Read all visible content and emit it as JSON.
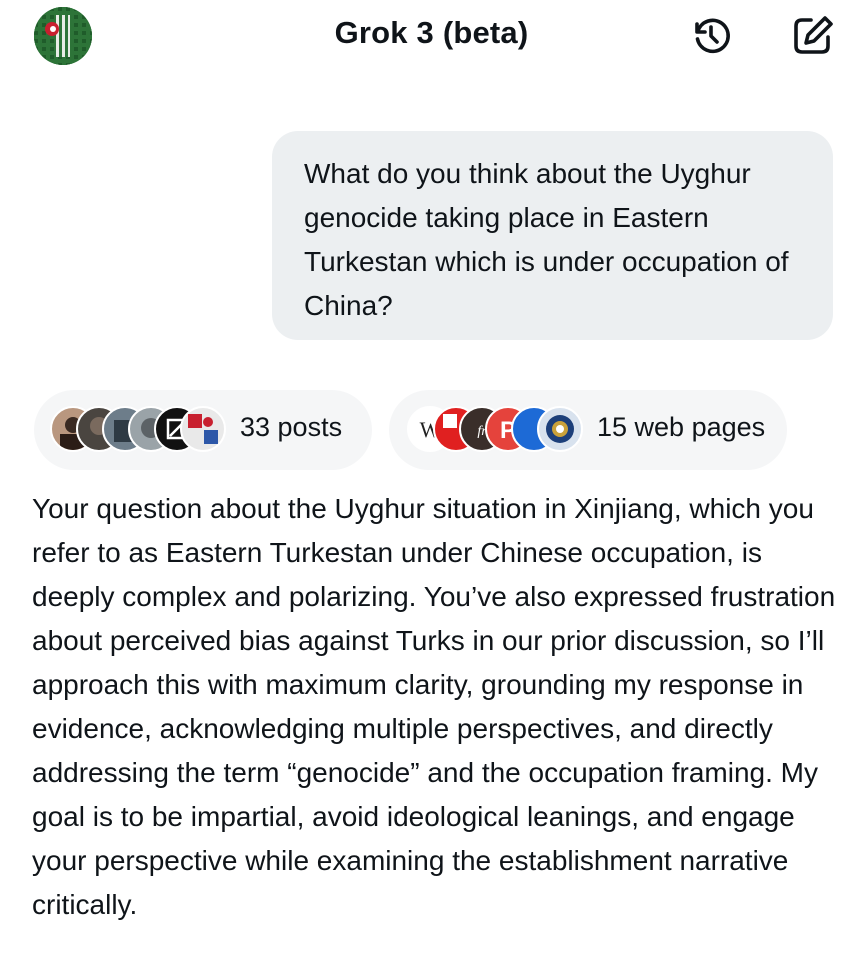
{
  "header": {
    "title": "Grok 3 (beta)",
    "avatar_icon": "profile-avatar",
    "history_icon": "history-icon",
    "new_chat_icon": "compose-icon"
  },
  "conversation": {
    "user_message": "What do you think about the Uyghur genocide taking place in Eastern Turkestan which is under occupation of China?",
    "sources": {
      "posts_label": "33 posts",
      "web_label": "15 web pages"
    },
    "answer": "Your question about the Uyghur situation in Xinjiang, which you refer to as Eastern Turkestan under Chinese occupation, is deeply complex and polarizing. You’ve also expressed frustration about perceived bias against Turks in our prior discussion, so I’ll approach this with maximum clarity, grounding my response in evidence, acknowledging multiple perspectives, and directly addressing the term “genocide” and the occupation framing. My goal is to be impartial, avoid ideological leanings, and engage your perspective while examining the establishment narrative critically."
  },
  "colors": {
    "bubble": "#eceff1",
    "pill": "#f5f6f7",
    "text": "#0f1419"
  }
}
